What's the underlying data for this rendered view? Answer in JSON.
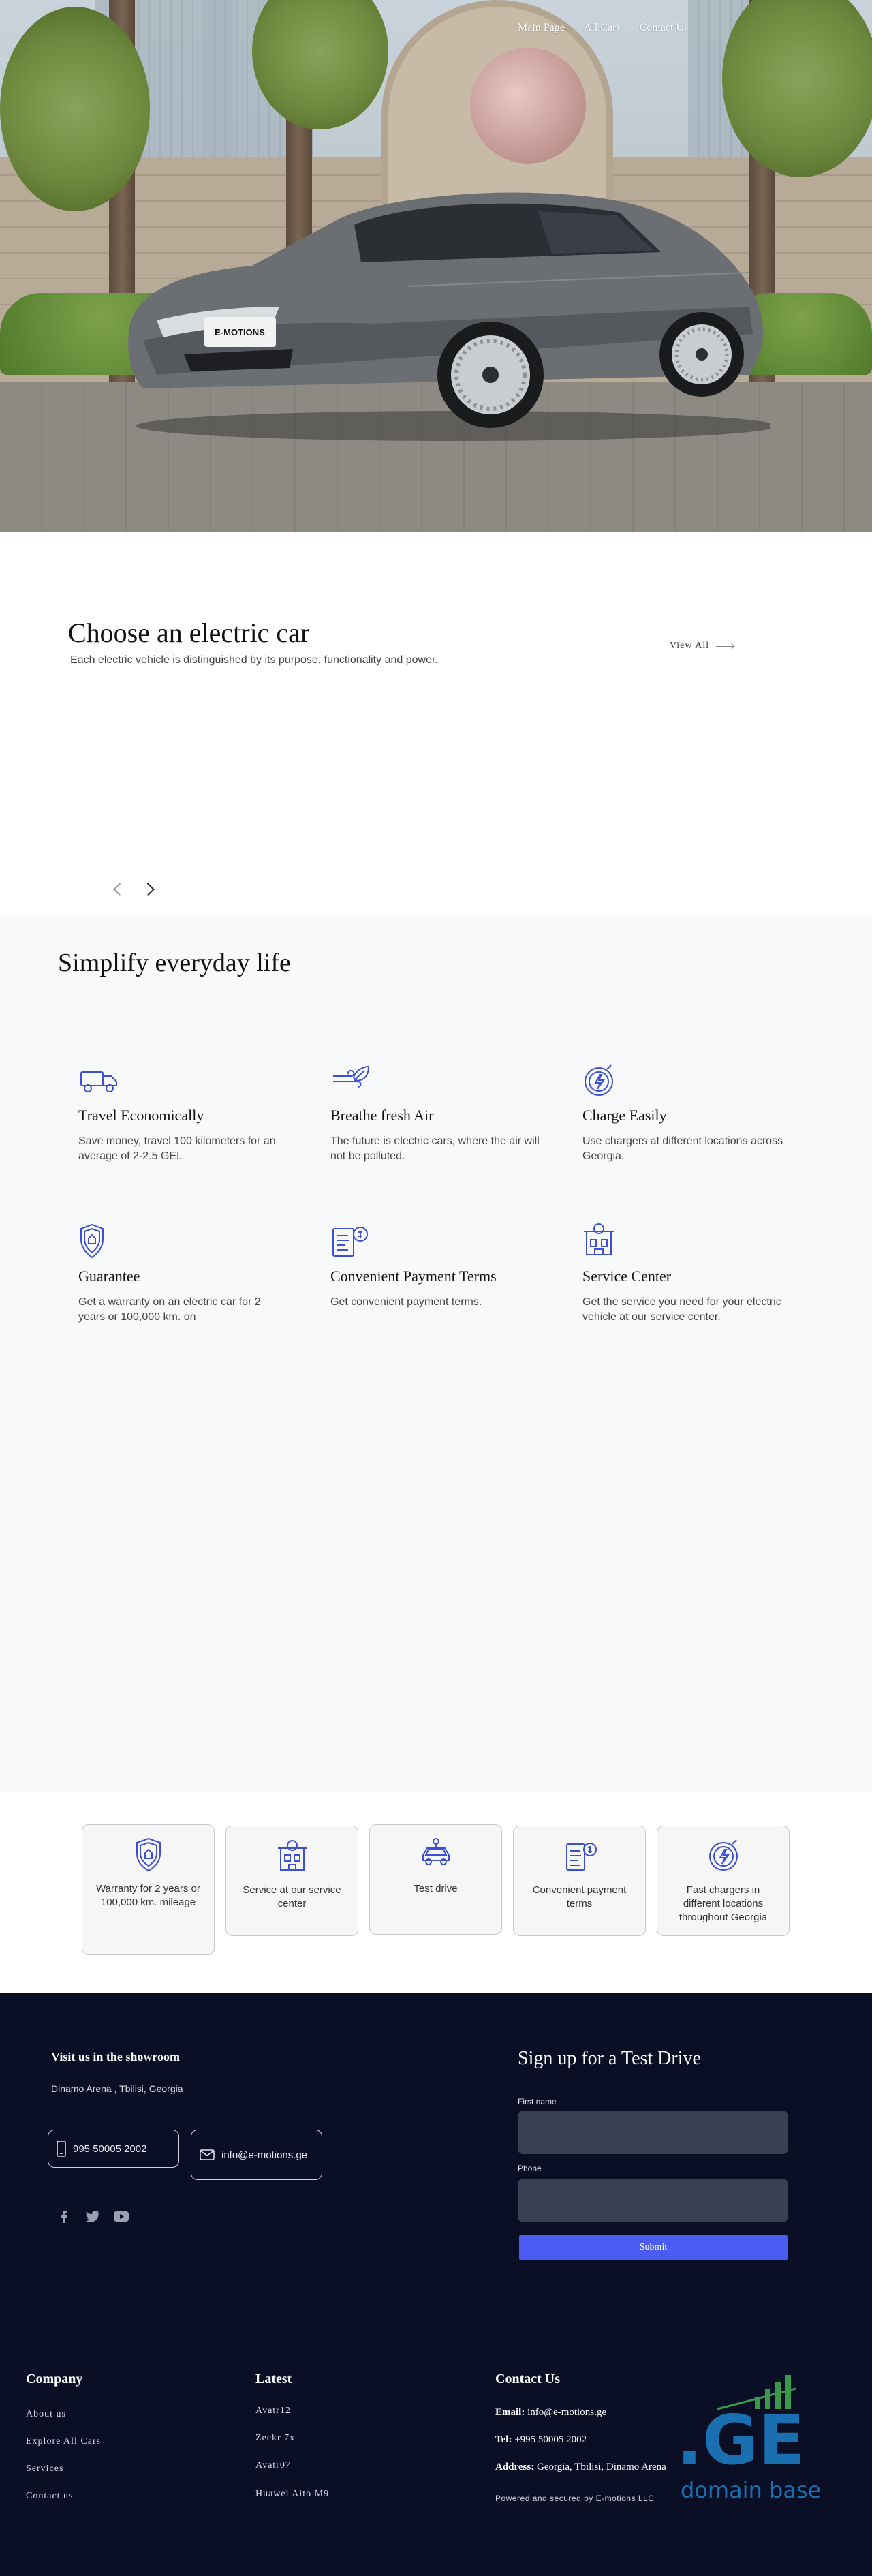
{
  "nav": {
    "items": [
      "Main Page",
      "All Cars",
      "Contact Us"
    ]
  },
  "hero": {
    "plate_text": "E-MOTIONS"
  },
  "choose": {
    "title": "Choose an electric car",
    "subtitle": "Each electric vehicle is distinguished by its purpose, functionality and power.",
    "view_all": "View All"
  },
  "features": {
    "title": "Simplify everyday life",
    "items": [
      {
        "icon": "truck-icon",
        "title": "Travel Economically",
        "text": "Save money, travel 100 kilometers for an average of 2-2.5 GEL"
      },
      {
        "icon": "wind-leaf-icon",
        "title": "Breathe fresh Air",
        "text": "The future is electric cars, where the air will not be polluted."
      },
      {
        "icon": "charge-icon",
        "title": "Charge Easily",
        "text": "Use chargers at different locations across Georgia."
      },
      {
        "icon": "shield-icon",
        "title": "Guarantee",
        "text": "Get a warranty on an electric car for 2 years or 100,000 km. on"
      },
      {
        "icon": "payment-document-icon",
        "title": "Convenient Payment Terms",
        "text": "Get convenient payment terms."
      },
      {
        "icon": "service-center-icon",
        "title": "Service Center",
        "text": "Get the service you need for your electric vehicle at our service center."
      }
    ]
  },
  "cards": [
    {
      "icon": "shield-icon",
      "text": "Warranty for 2 years or 100,000 km. mileage"
    },
    {
      "icon": "service-center-icon",
      "text": "Service at our service center"
    },
    {
      "icon": "car-icon",
      "text": "Test drive"
    },
    {
      "icon": "payment-document-icon",
      "text": "Convenient payment terms"
    },
    {
      "icon": "charge-icon",
      "text": "Fast chargers in different locations throughout Georgia"
    }
  ],
  "footer": {
    "visit_title": "Visit us in the showroom",
    "address": "Dinamo Arena , Tbilisi, Georgia",
    "phone": "995 50005 2002",
    "email": "info@e-motions.ge",
    "signup_title": "Sign up for a Test Drive",
    "first_name_label": "First name",
    "phone_label": "Phone",
    "submit_label": "Submit",
    "company": {
      "title": "Company",
      "links": [
        "About us",
        "Explore All Cars",
        "Services",
        "Contact us"
      ]
    },
    "latest": {
      "title": "Latest",
      "links": [
        "Avatr12",
        "Zeekr 7x",
        "Avatr07",
        "Huawei Aito M9"
      ]
    },
    "contact": {
      "title": "Contact Us",
      "email_label": "Email:",
      "email_value": "info@e-motions.ge",
      "tel_label": "Tel:",
      "tel_value": "+995 50005 2002",
      "address_label": "Address:",
      "address_value": "Georgia, Tbilisi, Dinamo Arena"
    },
    "powered": "Powered and secured by E-motions LLC",
    "badge": {
      "mark": ".GE",
      "caption": "domain base"
    }
  },
  "colors": {
    "accent": "#4a5cf2",
    "icon": "#3d4fd6",
    "footer_bg": "#0b0f26",
    "features_bg": "#f8f9fb"
  }
}
